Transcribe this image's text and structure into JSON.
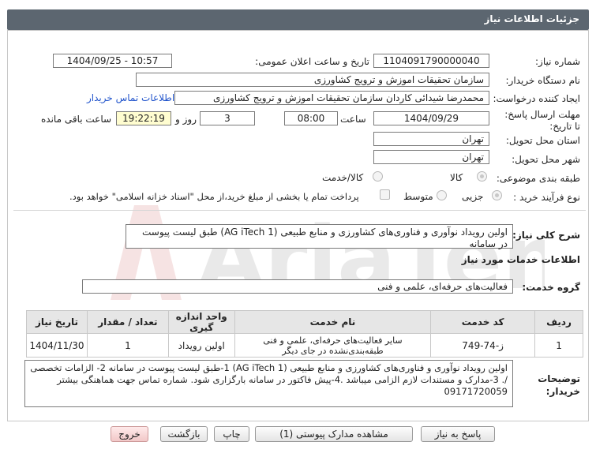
{
  "header": {
    "title": "جزئیات اطلاعات نیاز"
  },
  "fields": {
    "need_number": {
      "label": "شماره نیاز:",
      "value": "1104091790000040"
    },
    "announce_datetime": {
      "label": "تاریخ و ساعت اعلان عمومی:",
      "value": "1404/09/25 - 10:57"
    },
    "buyer_org": {
      "label": "نام دستگاه خریدار:",
      "value": "سازمان تحقیقات  اموزش و ترویج کشاورزی"
    },
    "requester": {
      "label": "ایجاد کننده درخواست:",
      "value": "محمدرضا شیدائی کاردان سازمان تحقیقات  اموزش و ترویج کشاورزی",
      "contact_link": "اطلاعات تماس خریدار"
    },
    "deadline": {
      "label": "مهلت ارسال پاسخ: تا تاریخ:",
      "date": "1404/09/29",
      "time_label": "ساعت",
      "time": "08:00",
      "days": "3",
      "days_label": "روز و",
      "remaining": "19:22:19",
      "remaining_label": "ساعت باقی مانده"
    },
    "delivery_province": {
      "label": "استان محل تحویل:",
      "value": "تهران"
    },
    "delivery_city": {
      "label": "شهر محل تحویل:",
      "value": "تهران"
    },
    "category": {
      "label": "طبقه بندی موضوعی:",
      "options": [
        "کالا",
        "کالا/خدمت"
      ]
    },
    "process_type": {
      "label": "نوع فرآیند خرید :",
      "options": [
        "جزیی",
        "متوسط"
      ],
      "payment_note": "پرداخت تمام یا بخشی از مبلغ خرید،از محل \"اسناد خزانه اسلامی\" خواهد بود."
    }
  },
  "need_summary": {
    "label": "شرح کلی نیاز:",
    "value": "اولین رویداد نوآوری و فناوری‌های کشاورزی و منابع طبیعی (AG iTech 1) طبق لیست پیوست در سامانه"
  },
  "services_section": {
    "title": "اطلاعات خدمات مورد نیاز",
    "group_label": "گروه خدمت:",
    "group_value": "فعالیت‌های حرفه‌ای، علمی و فنی"
  },
  "table": {
    "headers": [
      "ردیف",
      "کد خدمت",
      "نام خدمت",
      "واحد اندازه گیری",
      "تعداد / مقدار",
      "تاریخ نیاز"
    ],
    "rows": [
      [
        "1",
        "ز-74-749",
        "سایر فعالیت‌های حرفه‌ای، علمی و فنی طبقه‌بندی‌نشده در جای دیگر",
        "اولین رویداد",
        "1",
        "1404/11/30"
      ]
    ]
  },
  "buyer_notes": {
    "label": "توضیحات خریدار:",
    "value": "اولین رویداد نوآوری و فناوری‌های کشاورزی و منابع طبیعی (AG iTech 1)  1-طبق لیست پیوست در سامانه  2- الزامات تخصصی /.  3-مدارک و مستندات لازم الزامی میباشد .4-پیش فاکتور در سامانه بارگزاری شود. شماره تماس جهت هماهنگی بیشتر 09171720059"
  },
  "buttons": {
    "reply": "پاسخ به نیاز",
    "view_docs": "مشاهده مدارک پیوستی (1)",
    "print": "چاپ",
    "back": "بازگشت",
    "exit": "خروج"
  },
  "watermark": {
    "text": "AriaTender.net"
  },
  "colors": {
    "header_bg": "#5c6670",
    "remaining_bg": "#fffdd0",
    "link": "#2255cc",
    "exit_bg": "#f2c8c8"
  }
}
